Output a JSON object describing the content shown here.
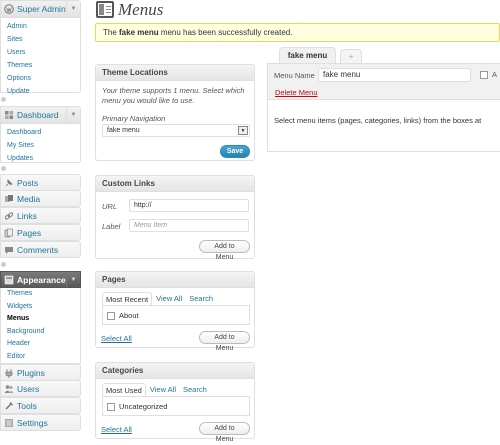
{
  "sidebar": {
    "super_admin": {
      "label": "Super Admin",
      "items": [
        "Admin",
        "Sites",
        "Users",
        "Themes",
        "Options",
        "Update"
      ]
    },
    "dashboard": {
      "label": "Dashboard",
      "items": [
        "Dashboard",
        "My Sites",
        "Updates"
      ]
    },
    "top_items": [
      "Posts",
      "Media",
      "Links",
      "Pages",
      "Comments"
    ],
    "appearance": {
      "label": "Appearance",
      "items": [
        "Themes",
        "Widgets",
        "Menus",
        "Background",
        "Header",
        "Editor"
      ],
      "current": "Menus"
    },
    "bottom_items": [
      "Plugins",
      "Users",
      "Tools",
      "Settings"
    ]
  },
  "page": {
    "title": "Menus"
  },
  "notice": {
    "prefix": "The ",
    "menu_name": "fake menu",
    "suffix": " menu has been successfully created."
  },
  "theme_locations": {
    "title": "Theme Locations",
    "description": "Your theme supports 1 menu. Select which menu you would like to use.",
    "primary_label": "Primary Navigation",
    "selected": "fake menu",
    "save_label": "Save"
  },
  "custom_links": {
    "title": "Custom Links",
    "url_label": "URL",
    "url_value": "http://",
    "label_label": "Label",
    "label_placeholder": "Menu Item",
    "add_label": "Add to Menu"
  },
  "pages_box": {
    "title": "Pages",
    "tabs": [
      "Most Recent",
      "View All",
      "Search"
    ],
    "items": [
      "About"
    ],
    "select_all": "Select All",
    "add_label": "Add to Menu"
  },
  "categories_box": {
    "title": "Categories",
    "tabs": [
      "Most Used",
      "View All",
      "Search"
    ],
    "items": [
      "Uncategorized"
    ],
    "select_all": "Select All",
    "add_label": "Add to Menu"
  },
  "menu_editor": {
    "tab_label": "fake menu",
    "plus_label": "+",
    "name_label": "Menu Name",
    "name_value": "fake menu",
    "auto_label": "A",
    "delete_label": "Delete Menu",
    "instructions": "Select menu items (pages, categories, links) from the boxes at"
  },
  "colors": {
    "link": "#21759b",
    "notice_bg": "#ffffe0",
    "delete": "#bc0b0b",
    "primary": "#2583b8"
  }
}
